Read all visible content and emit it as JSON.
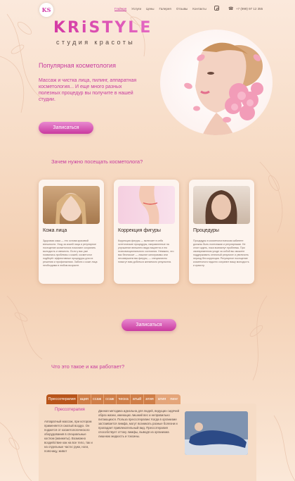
{
  "header": {
    "logo_mark": "KS",
    "nav": [
      "Главная",
      "Услуги",
      "Цены",
      "Галерея",
      "Отзывы",
      "Контакты"
    ],
    "phone": "+7 (999) 97 12 355"
  },
  "hero": {
    "brand": "KRiSTYLE",
    "tagline": "студия красоты",
    "title": "Популярная косметология",
    "text": "Массаж и чистка лица, пилинг, аппаратная косметология... И еще много разных полезных процедур вы получите в нашей студии.",
    "button": "Записаться"
  },
  "why": {
    "title": "Зачем нужно посещать косметолога?",
    "cards": [
      {
        "title": "Кожа лица",
        "text": "Здоровая кожа — это основа красивой внешности. Уход за кожей лица и регулярное посещение косметолога помогают сохранить молодость и свежесть. Если у вас уже появились проблемы с кожей, косметолог подберёт эффективные процедуры для их решения и профилактики. Забота о коже лица необходима в любом возрасте."
      },
      {
        "title": "Коррекция фигуры",
        "text": "Коррекция фигуры — включает в себя эстетические процедуры, направленные на улучшение внешнего вида пациента и его психоэмоционального состояния. Неважно, что вас беспокоит — лишние килограммы или несовершенства фигуры, — специалисты помогут вам добиться желаемого результата."
      },
      {
        "title": "Процедуры",
        "text": "Процедуры в косметологическом кабинете должны быть полезными и регулярными. Не стоит ждать, пока возникнут проблемы. При своевременном уходе за собой вы сможете поддерживать отличный результат и увеличить период без коррекции. Регулярное посещение косметолога надолго сохранит вашу молодость и красоту."
      }
    ],
    "button": "Записаться"
  },
  "how": {
    "title": "Что это такое и как работает?",
    "tabs": [
      "Прессотерапия",
      "ация",
      "ссаж",
      "ссаж",
      "ческа",
      "атый",
      "атия",
      "атия",
      "пинг"
    ],
    "active_tab": "Прессотерапия",
    "panel_title": "Прессотерапия",
    "text_left": "Аппаратный массаж, при котором применяется сжатый воздух. Он подается от косметологического оборудования в специальные костюм (манжеты). Возможно воздействие как на все тело, так и на отдельные части: руки, ноги, поясницу, живот",
    "text_right": "Данная методика идеальна для людей, ведущих сидячий образ жизни, имеющих лишний вес и неправильно питающихся. Польза прессотерапии: Когда в организме застаивается лимфа, могут возникать разные болезни и пропадает привлекательный вид. Прессотерапия способствует оттоку лимфы, выводя из организма лишнюю жидкость и токсины."
  },
  "colors": {
    "accent": "#c73b9e",
    "tab": "#cf7e48",
    "tab_active": "#b8551b"
  }
}
